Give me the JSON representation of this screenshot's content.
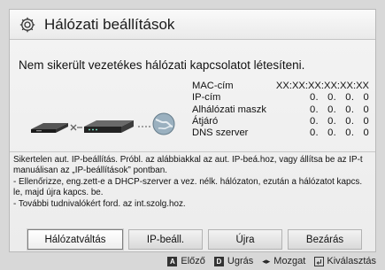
{
  "dialog": {
    "title": "Hálózati beállítások",
    "error_message": "Nem sikerült vezetékes hálózati kapcsolatot létesíteni."
  },
  "network_info": [
    {
      "label": "MAC-cím",
      "value": "XX:XX:XX:XX:XX:XX"
    },
    {
      "label": "IP-cím",
      "value": "0.   0.   0.   0"
    },
    {
      "label": "Alhálózati maszk",
      "value": "0.   0.   0.   0"
    },
    {
      "label": "Átjáró",
      "value": "0.   0.   0.   0"
    },
    {
      "label": "DNS szerver",
      "value": "0.   0.   0.   0"
    }
  ],
  "help_text": [
    "Sikertelen aut. IP-beállítás. Próbl. az alábbiakkal az aut. IP-beá.hoz, vagy állítsa be az IP-t manuálisan az „IP-beállítások” pontban.",
    "- Ellenőrizze, eng.zett-e a DHCP-szerver a vez. nélk. hálózaton, ezután a hálózatot kapcs. le, majd újra kapcs. be.",
    "- További tudnivalókért ford. az int.szolg.hoz."
  ],
  "buttons": {
    "network_switch": "Hálózatváltás",
    "ip_settings": "IP-beáll.",
    "retry": "Újra",
    "close": "Bezárás"
  },
  "hints": {
    "previous": {
      "key": "A",
      "label": "Előző"
    },
    "jump": {
      "key": "D",
      "label": "Ugrás"
    },
    "move": {
      "label": "Mozgat"
    },
    "select": {
      "label": "Kiválasztás"
    }
  }
}
